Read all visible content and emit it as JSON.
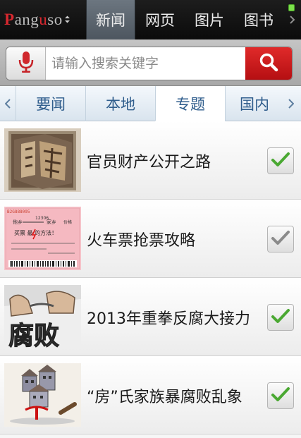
{
  "brand": {
    "logo_p": "P",
    "logo_mid": "ang",
    "logo_u": "u",
    "logo_end": "so"
  },
  "category_tabs": [
    {
      "label": "新闻",
      "active": true
    },
    {
      "label": "网页",
      "active": false
    },
    {
      "label": "图片",
      "active": false
    },
    {
      "label": "图书",
      "active": false
    }
  ],
  "search": {
    "placeholder": "请输入搜索关键字",
    "value": ""
  },
  "sub_tabs": [
    {
      "label": "要闻",
      "active": false
    },
    {
      "label": "本地",
      "active": false
    },
    {
      "label": "专题",
      "active": true
    },
    {
      "label": "国内",
      "active": false
    }
  ],
  "topics": [
    {
      "title": "官员财产公开之路",
      "checked": true,
      "check_color": "#4aa832"
    },
    {
      "title": "火车票抢票攻略",
      "checked": true,
      "check_color": "#8a8a8a"
    },
    {
      "title": "2013年重拳反腐大接力",
      "checked": true,
      "check_color": "#4aa832"
    },
    {
      "title": "“房”氏家族暴腐败乱象",
      "checked": true,
      "check_color": "#4aa832"
    }
  ],
  "thumb_text": {
    "ticket_no": "B2G888095",
    "ticket_left": "他乡",
    "ticket_mid": "12306",
    "ticket_right": "家乡",
    "ticket_fare": "价格",
    "ticket_line": "买票 最 的方法！",
    "anticorruption": "腐败"
  },
  "colors": {
    "accent_red": "#d7282f",
    "tab_blue": "#2f5d8c",
    "check_green": "#4aa832"
  }
}
